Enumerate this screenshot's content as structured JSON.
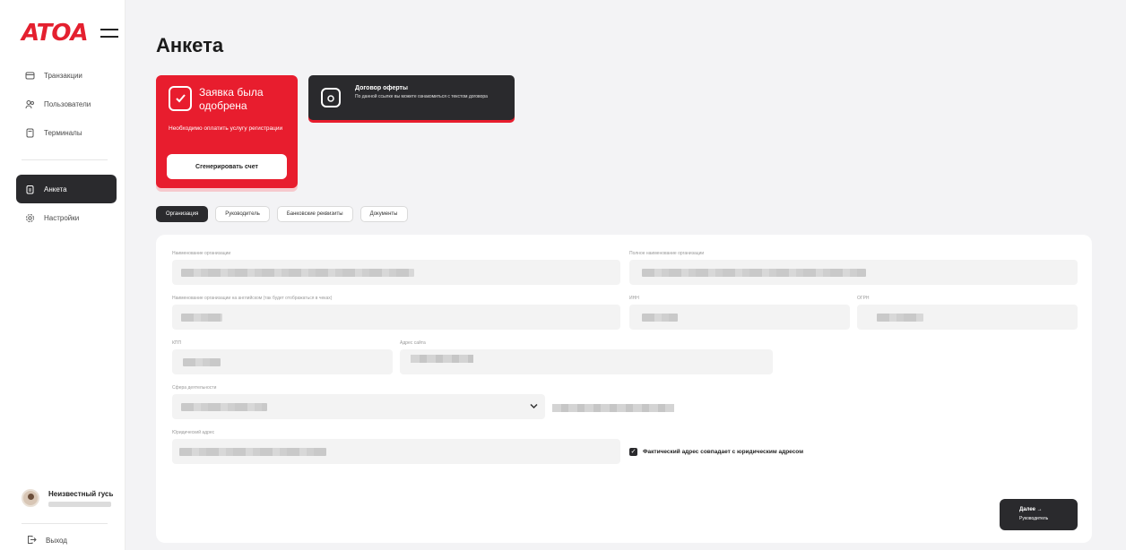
{
  "sidebar": {
    "logo": "ATOA",
    "nav": [
      {
        "label": "Транзакции",
        "icon": "card-icon"
      },
      {
        "label": "Пользователи",
        "icon": "users-icon"
      },
      {
        "label": "Терминалы",
        "icon": "terminal-icon"
      }
    ],
    "nav2": [
      {
        "label": "Анкета",
        "icon": "clipboard-icon",
        "active": true
      },
      {
        "label": "Настройки",
        "icon": "gear-icon"
      }
    ],
    "user": {
      "name": "Неизвестный гусь"
    },
    "logout": "Выход"
  },
  "page": {
    "title": "Анкета",
    "status_card": {
      "title": "Заявка была одобрена",
      "description": "Необходимо оплатить услугу регистрации",
      "button": "Сгенерировать счет"
    },
    "offer_card": {
      "title": "Договор оферты",
      "description": "По данной ссылке вы можете ознакомиться с текстом договора"
    },
    "tabs": [
      "Организация",
      "Руководитель",
      "Банковские реквизиты",
      "Документы"
    ],
    "form": {
      "org_name_label": "Наименование организации",
      "full_org_name_label": "Полное наименование организации",
      "org_name_en_label": "Наименование организации на английском (так будет отображаться в чеках)",
      "inn_label": "ИНН",
      "ogrn_label": "ОГРН",
      "kpp_label": "КПП",
      "site_label": "Адрес сайта",
      "site_value": "www.lorem.ru",
      "activity_label": "Сфера деятельности",
      "legal_address_label": "Юридический адрес",
      "same_address_label": "Фактический адрес совпадает с юридическим адресом"
    },
    "next_button": {
      "line1": "Далее →",
      "line2": "Руководитель"
    }
  }
}
